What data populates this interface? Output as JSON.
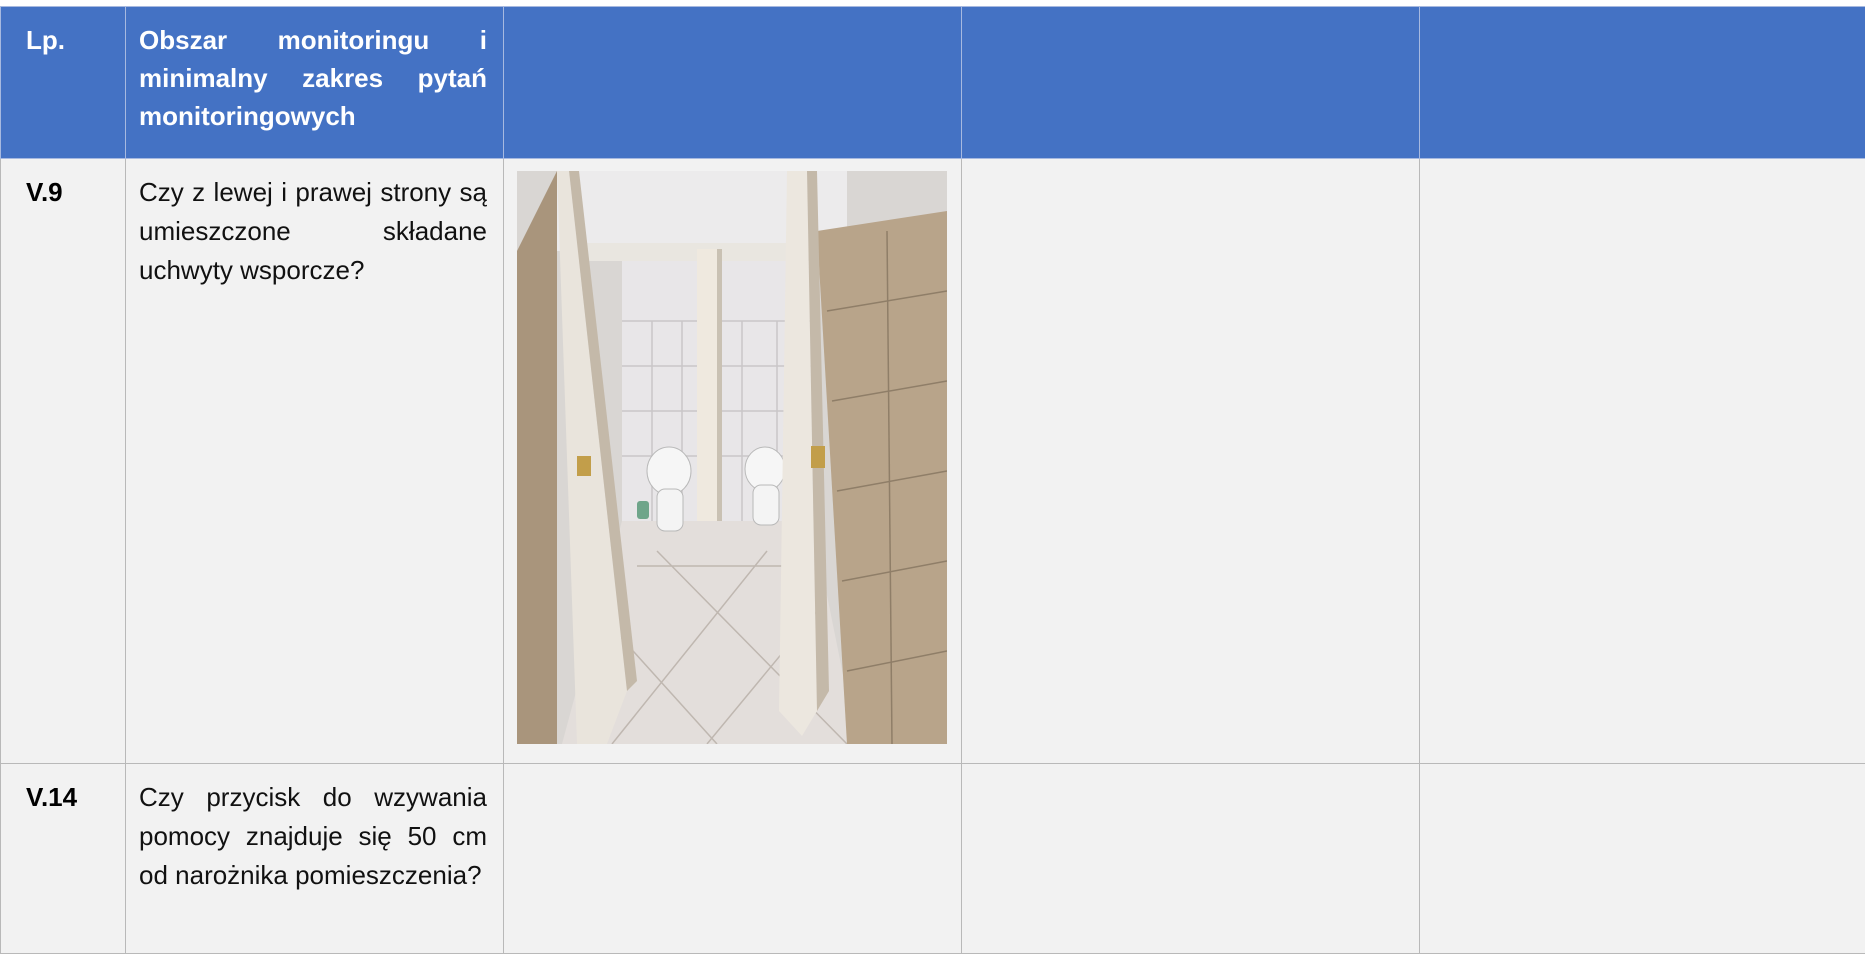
{
  "table": {
    "headers": {
      "lp": "Lp.",
      "question": "Obszar monitoringu i minimalny zakres pytań monitoringowych",
      "col3": "",
      "col4": "",
      "col5": ""
    },
    "rows": [
      {
        "lp": "V.9",
        "question": "Czy z lewej i prawej strony są umieszczone składane uchwyty wsporcze?",
        "has_photo": true
      },
      {
        "lp": "V.14",
        "question": "Czy przycisk do wzywania pomocy znajduje się 50 cm od narożnika pomieszczenia?",
        "has_photo": false
      }
    ]
  },
  "colors": {
    "header_bg": "#4472c4",
    "header_text": "#ffffff",
    "cell_bg": "#f2f2f2",
    "border": "#b9b9b9"
  }
}
